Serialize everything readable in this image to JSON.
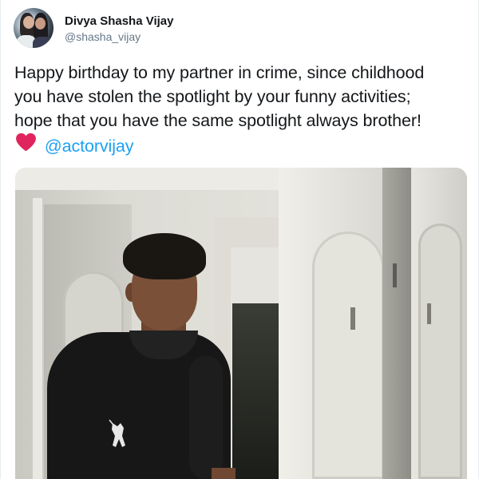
{
  "tweet": {
    "author_name": "Divya Shasha Vijay",
    "author_handle": "@shasha_vijay",
    "lines": [
      "Happy birthday to my partner in crime, since childhood",
      "you have stolen the spotlight by your funny activities;",
      "hope that you have the same spotlight always brother!"
    ],
    "mention": "@actorvijay",
    "heart_emoji": "heart-emoji",
    "mention_color": "#1da1f2",
    "heart_color": "#e0245e"
  }
}
